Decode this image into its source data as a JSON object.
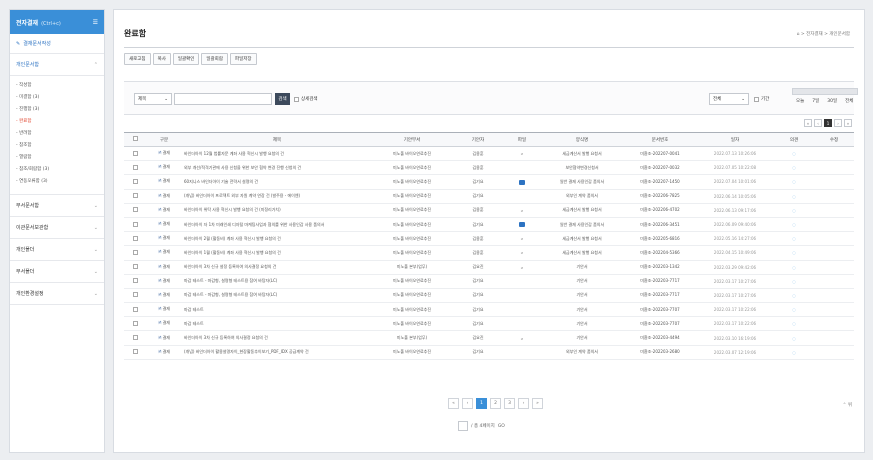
{
  "sidebar": {
    "title": "전자결재",
    "title_sub": "(Ctrl+c)",
    "menu_icon": "☰",
    "write_label": "결재문서작성",
    "sections": [
      {
        "label": "개인문서함",
        "items": [
          "작성함",
          "미결함 (3)",
          "진행함 (3)",
          "완료함",
          "반려함",
          "참조함",
          "열람함",
          "참조/회람함 (3)",
          "연동오류함 (3)"
        ]
      },
      {
        "label": "부서문서함"
      },
      {
        "label": "이관문서보관함"
      },
      {
        "label": "개인폴더"
      },
      {
        "label": "부서폴더"
      },
      {
        "label": "개인환경설정"
      }
    ],
    "active_item": "완료함"
  },
  "page": {
    "title": "완료함",
    "breadcrumb": "⌂ > 전자결재 > 개인문서함",
    "buttons": [
      "새로고침",
      "복사",
      "일괄확인",
      "일괄회람",
      "파일저장"
    ],
    "search": {
      "scope": "제목",
      "button": "검색",
      "detail": "상세검색",
      "period_select": "전체",
      "period_label": "기간",
      "quick_links": [
        "오늘",
        "7일",
        "30일",
        "전체"
      ]
    },
    "mini_pager": [
      "«",
      "‹",
      "1",
      "›",
      "»"
    ]
  },
  "table": {
    "headers": [
      "",
      "구분",
      "제목",
      "기안부서",
      "기안자",
      "파일",
      "양식명",
      "문서번호",
      "일자",
      "의견",
      "수정"
    ],
    "rows": [
      [
        "결재",
        "바인더아이 12월 법률자문 계좌 사용 혁신시 발행 요청의 건",
        "미노풀 바이오연료추진",
        "김용훈",
        "clip",
        "세금계산서 발행 요청서",
        "미환조-202207-0041",
        "2022.07.13 10:26:06"
      ],
      [
        "결재",
        "외부 개선/적격기관에 사용 신청을 위한 보안 협약 변경 진행 신청의 건",
        "미노풀 바이오연료추진",
        "김용훈",
        "",
        "보안협약변경신청서",
        "미환조-202207-0032",
        "2022.07.05 10:22:08"
      ],
      [
        "결재",
        "60지니스 바인더아이 기술 전략서 설명의 건",
        "미노풀 바이오연료추진",
        "김기요",
        "mail",
        "일반 결재 사용인감 품의서",
        "미환조-202207-1450",
        "2022.07.04 10:01:06"
      ],
      [
        "결재",
        "(개념) 바인더아이 프로젝트 외부 자원 계약 연장 건 (발주용 - 에이엔)",
        "미노풀 바이오연료추진",
        "김기요",
        "",
        "외부인 계약 품의서",
        "미환조-202206-7825",
        "2022.06.14 10:05:06"
      ],
      [
        "결재",
        "바인더아이 위탁 사용 혁신시 발행 요청의 건 (미정리가치)",
        "미노풀 바이오연료추진",
        "김용훈",
        "clip",
        "세금계산서 발행 요청서",
        "미환조-202206-4702",
        "2022.06.13 09:17:06"
      ],
      [
        "결재",
        "바인더아이 자 1차 미래인쇄 디자털 마케팅사업과 협의를 위한 사용인감 사용 품의서",
        "미노풀 바이오연료추진",
        "김기요",
        "mail",
        "일반 결재 사용인감 품의서",
        "미환조-202206-3451",
        "2022.06.09 09:40:06"
      ],
      [
        "결재",
        "바인더아이 2월 (활동비) 계좌 사용 혁신시 발행 요청의 건",
        "미노풀 바이오연료추진",
        "김용훈",
        "clip",
        "세금계산서 발행 요청서",
        "미환조-202205-6816",
        "2022.05.16 14:27:06"
      ],
      [
        "결재",
        "바인더아이 1월 (활동비) 계좌 사용 혁신시 발행 요청의 건",
        "미노풀 바이오연료추진",
        "김용훈",
        "clip",
        "세금계산서 발행 요청서",
        "미환조-202204-5366",
        "2022.04.15 10:49:06"
      ],
      [
        "결재",
        "바인더아이 3차 신규 설정 등록하여 의사결정 요청의 건",
        "미노풀 본부(업무)",
        "김요진",
        "clip",
        "기안서",
        "미환조-202203-1342",
        "2022.03.29 09:42:06"
      ],
      [
        "결재",
        "마감 테스트 - 마감형, 설명형 테스트용 참여 바탕자(LC)",
        "미노풀 바이오연료추진",
        "김기요",
        "",
        "기안서",
        "미환조-202203-7717",
        "2022.03.17 10:27:06"
      ],
      [
        "결재",
        "마감 테스트 - 마감형, 설명형 테스트용 참여 바탕자(LC)",
        "미노풀 바이오연료추진",
        "김기요",
        "",
        "기안서",
        "미환조-202203-7717",
        "2022.03.17 10:27:06"
      ],
      [
        "결재",
        "마감 테스트",
        "미노풀 바이오연료추진",
        "김기요",
        "",
        "기안서",
        "미환조-202203-7707",
        "2022.03.17 10:22:06"
      ],
      [
        "결재",
        "마감 테스트",
        "미노풀 바이오연료추진",
        "김기요",
        "",
        "기안서",
        "미환조-202203-7707",
        "2022.03.17 10:22:06"
      ],
      [
        "결재",
        "바인더아이 3차 신규 등록하여 의사결정 요청의 건",
        "미노풀 본부(업무)",
        "김요진",
        "clip",
        "기안서",
        "미환조-202203-4494",
        "2022.03.10 16:19:06"
      ],
      [
        "결재",
        "(개념) 바인더아이 활용설명자이_현장활동추이보기_PDF_IDX 공급계약 건",
        "미노풀 바이오연료추진",
        "김기요",
        "",
        "외부인 계약 품의서",
        "미환조-202203-2680",
        "2022.03.07 12:19:06"
      ]
    ]
  },
  "pagination": {
    "pages": [
      "«",
      "‹",
      "1",
      "2",
      "3",
      "›",
      "»"
    ],
    "current": "1",
    "go_label": "/ 총 4페이지",
    "go_button": "GO",
    "top_label": "⌃ 위"
  },
  "colors": {
    "accent": "#3a8fd8",
    "selected_menu": "#e0452e",
    "search_button": "#3d4a5c"
  }
}
